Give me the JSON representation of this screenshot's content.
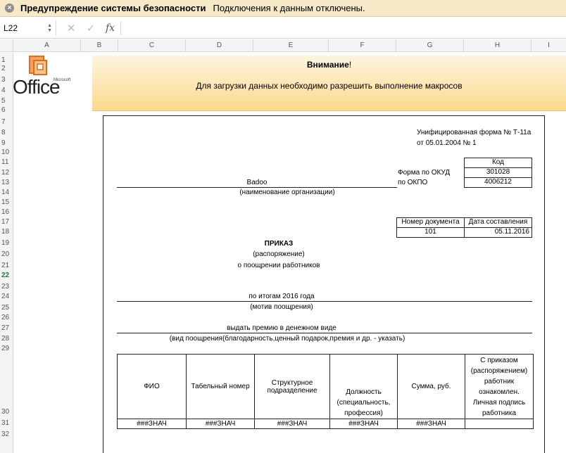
{
  "security_bar": {
    "title": "Предупреждение системы безопасности",
    "message": "Подключения к данным отключены."
  },
  "formula_bar": {
    "name_box": "L22",
    "cancel_icon": "✕",
    "enter_icon": "✓",
    "fx_label": "fx",
    "formula": ""
  },
  "columns": [
    "A",
    "B",
    "C",
    "D",
    "E",
    "F",
    "G",
    "H",
    "I"
  ],
  "rows": [
    "1",
    "2",
    "3",
    "4",
    "5",
    "6",
    "7",
    "8",
    "9",
    "10",
    "11",
    "12",
    "13",
    "14",
    "15",
    "16",
    "17",
    "18",
    "19",
    "20",
    "21",
    "22",
    "23",
    "24",
    "25",
    "26",
    "27",
    "28",
    "29",
    "30",
    "31",
    "32"
  ],
  "active_row": "22",
  "logo": {
    "word": "Office",
    "brand": "Microsoft"
  },
  "banner": {
    "title": "Внимание",
    "title_suffix": "!",
    "message": "Для загрузки данных необходимо разрешить выполнение макросов"
  },
  "form": {
    "header_line1": "Унифицированная форма № Т-11а",
    "header_line2": "от 05.01.2004 № 1",
    "code_label": "Код",
    "okud_label": "Форма по ОКУД",
    "okud_code": "301028",
    "okpo_label": "по ОКПО",
    "okpo_code": "4006212",
    "org_name": "Badoo",
    "org_caption": "(наименование организации)",
    "doc_number_label": "Номер документа",
    "doc_date_label": "Дата составления",
    "doc_number": "101",
    "doc_date": "05.11.2016",
    "title": "ПРИКАЗ",
    "subtitle": "(распоряжение)",
    "subject": "о поощрении работников",
    "motive": "по итогам 2016 года",
    "motive_caption": "(мотив поощрения)",
    "reward": "выдать премию в денежном виде",
    "reward_caption": "(вид поощрения(благодарность,ценный подарок,премия и др. - указать)",
    "table": {
      "headers": [
        "ФИО",
        "Табельный номер",
        "Структурное подразделение",
        "Должность (специальность, профессия)",
        "Сумма, руб.",
        "С приказом (распоряжением) работник ознакомлен. Личная подпись работника"
      ],
      "row": [
        "###ЗНАЧ",
        "###ЗНАЧ",
        "###ЗНАЧ",
        "###ЗНАЧ",
        "###ЗНАЧ",
        ""
      ]
    }
  }
}
